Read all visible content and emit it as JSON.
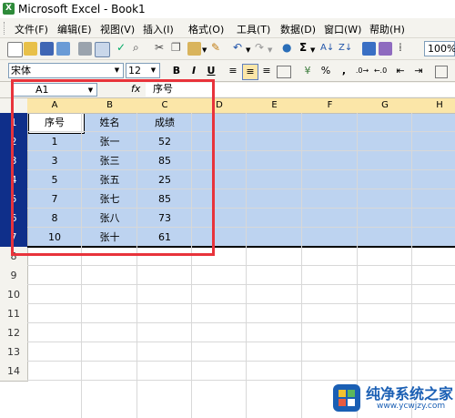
{
  "window": {
    "app_icon_letter": "X",
    "title": "Microsoft Excel - Book1"
  },
  "menu": {
    "items": [
      "文件(F)",
      "编辑(E)",
      "视图(V)",
      "插入(I)",
      "格式(O)",
      "工具(T)",
      "数据(D)",
      "窗口(W)",
      "帮助(H)"
    ]
  },
  "toolbar": {
    "zoom": "100%"
  },
  "format_toolbar": {
    "font_name": "宋体",
    "font_size": "12",
    "bold": "B",
    "italic": "I",
    "underline": "U",
    "percent": "%",
    "comma": ","
  },
  "formula_bar": {
    "name_box": "A1",
    "fx": "fx",
    "content": "序号"
  },
  "sheet": {
    "columns": [
      "A",
      "B",
      "C",
      "D",
      "E",
      "F",
      "G",
      "H"
    ],
    "rows": [
      "1",
      "2",
      "3",
      "4",
      "5",
      "6",
      "7",
      "8",
      "9",
      "10",
      "11",
      "12",
      "13",
      "14"
    ],
    "data": [
      [
        "序号",
        "姓名",
        "成绩"
      ],
      [
        "1",
        "张一",
        "52"
      ],
      [
        "3",
        "张三",
        "85"
      ],
      [
        "5",
        "张五",
        "25"
      ],
      [
        "7",
        "张七",
        "85"
      ],
      [
        "8",
        "张八",
        "73"
      ],
      [
        "10",
        "张十",
        "61"
      ]
    ],
    "selection_fill_color": "#bdd3f0",
    "highlight_box_color": "#e8333b"
  },
  "watermark": {
    "title": "纯净系统之家",
    "url": "www.ycwjzy.com"
  }
}
